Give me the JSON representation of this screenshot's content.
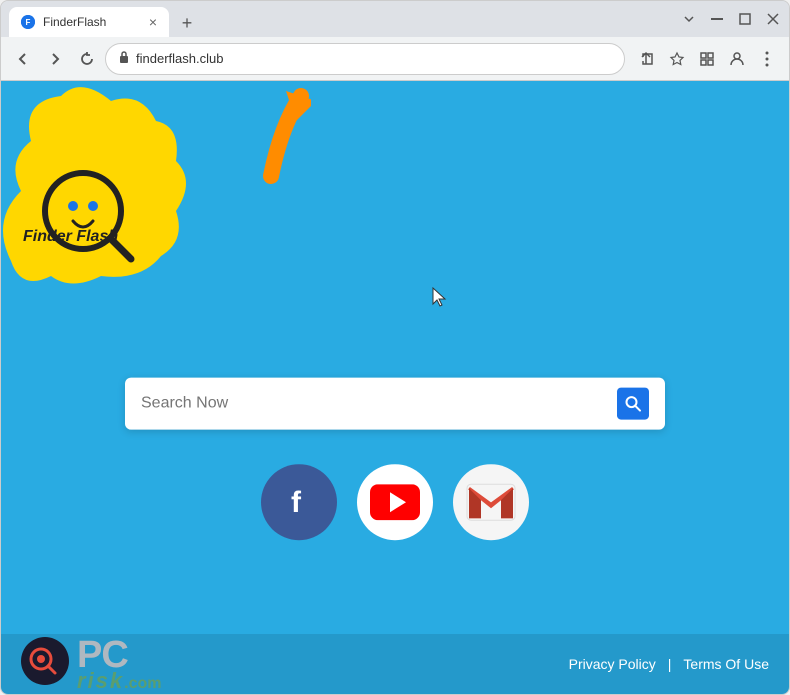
{
  "browser": {
    "tab": {
      "favicon_label": "F",
      "title": "FinderFlash",
      "close_label": "×"
    },
    "new_tab_label": "+",
    "window_controls": {
      "minimize": "—",
      "maximize": "⬜",
      "close": "✕"
    },
    "toolbar": {
      "back_label": "←",
      "forward_label": "→",
      "refresh_label": "↻",
      "address": "finderflash.club",
      "lock_icon": "🔒",
      "share_label": "⬆",
      "bookmark_label": "☆",
      "extensions_label": "⬜",
      "profile_label": "👤",
      "menu_label": "⋮"
    }
  },
  "page": {
    "background_color": "#29abe2",
    "logo": {
      "name": "FinderFlash",
      "tagline": "Finder Flash"
    },
    "search": {
      "placeholder": "Search Now"
    },
    "social": [
      {
        "name": "Facebook",
        "type": "facebook"
      },
      {
        "name": "YouTube",
        "type": "youtube"
      },
      {
        "name": "Gmail",
        "type": "gmail"
      }
    ],
    "footer": {
      "privacy_policy": "Privacy Policy",
      "divider": "|",
      "terms_of_use": "Terms Of Use"
    }
  }
}
